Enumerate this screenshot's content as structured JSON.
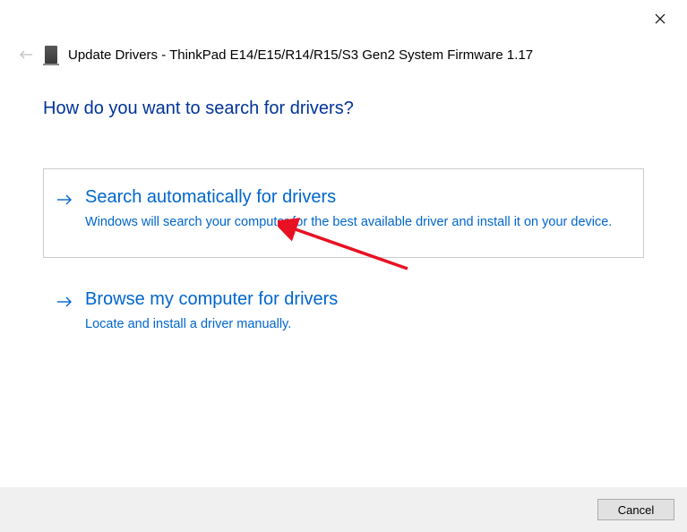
{
  "header": {
    "title": "Update Drivers - ThinkPad E14/E15/R14/R15/S3 Gen2 System Firmware 1.17"
  },
  "heading": "How do you want to search for drivers?",
  "options": [
    {
      "title": "Search automatically for drivers",
      "description": "Windows will search your computer for the best available driver and install it on your device."
    },
    {
      "title": "Browse my computer for drivers",
      "description": "Locate and install a driver manually."
    }
  ],
  "footer": {
    "cancel_label": "Cancel"
  }
}
